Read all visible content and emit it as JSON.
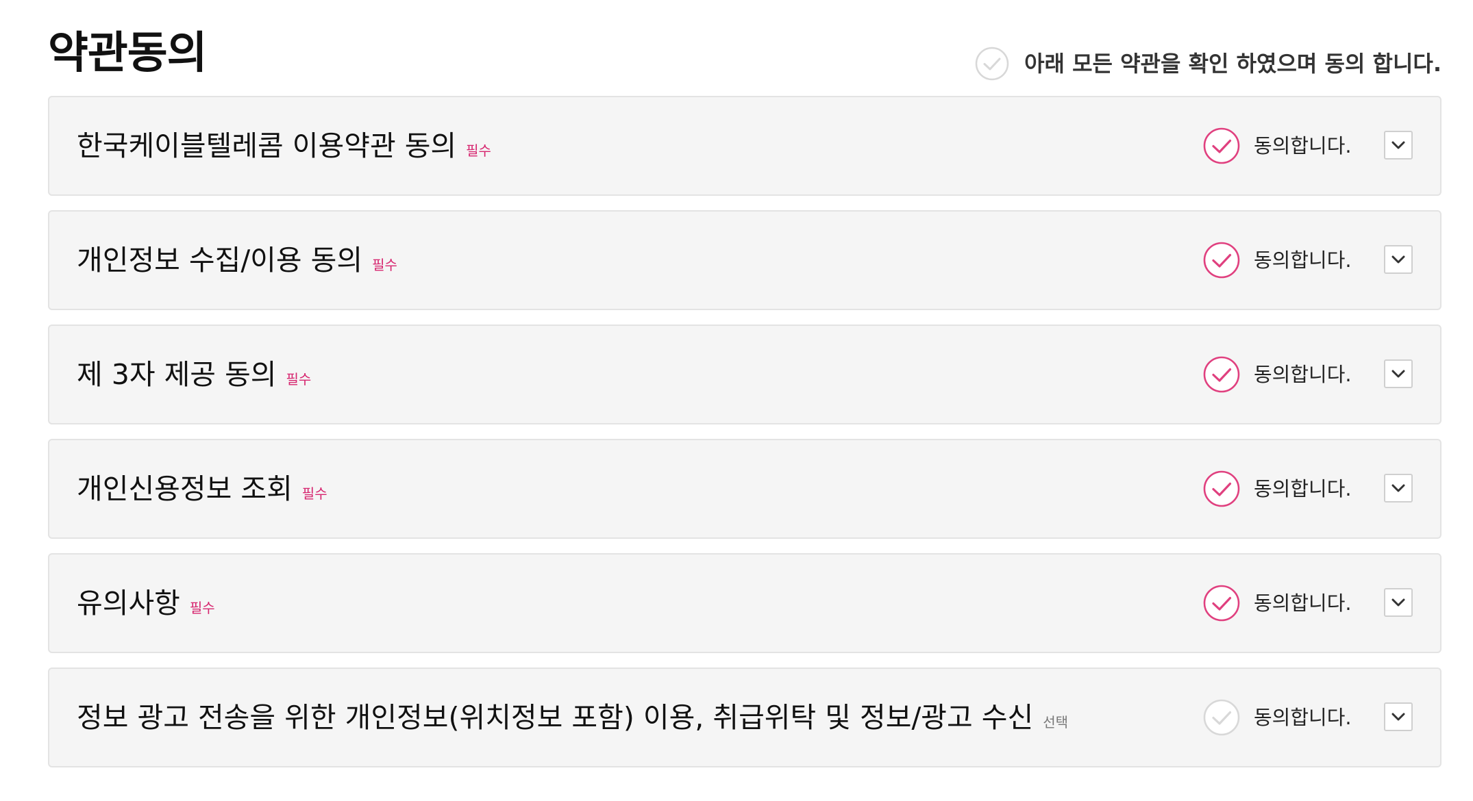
{
  "header": {
    "title": "약관동의",
    "agree_all_label": "아래 모든 약관을 확인 하였으며 동의 합니다.",
    "agree_all_checked": false
  },
  "colors": {
    "accent": "#e0407f",
    "required_badge": "#d6246e",
    "optional_badge": "#777777",
    "unchecked": "#d8d8d8",
    "row_background": "#f5f5f5",
    "row_border": "#e3e3e3"
  },
  "icons": {
    "agree_check": "check-circle-icon",
    "expand": "chevron-down-icon"
  },
  "terms": [
    {
      "title": "한국케이블텔레콤 이용약관 동의",
      "badge": "필수",
      "required": true,
      "agree_label": "동의합니다.",
      "checked": true
    },
    {
      "title": "개인정보 수집/이용 동의",
      "badge": "필수",
      "required": true,
      "agree_label": "동의합니다.",
      "checked": true
    },
    {
      "title": "제 3자 제공 동의",
      "badge": "필수",
      "required": true,
      "agree_label": "동의합니다.",
      "checked": true
    },
    {
      "title": "개인신용정보 조회",
      "badge": "필수",
      "required": true,
      "agree_label": "동의합니다.",
      "checked": true
    },
    {
      "title": "유의사항",
      "badge": "필수",
      "required": true,
      "agree_label": "동의합니다.",
      "checked": true
    },
    {
      "title": "정보 광고 전송을 위한 개인정보(위치정보 포함) 이용, 취급위탁 및 정보/광고 수신",
      "badge": "선택",
      "required": false,
      "agree_label": "동의합니다.",
      "checked": false
    }
  ]
}
